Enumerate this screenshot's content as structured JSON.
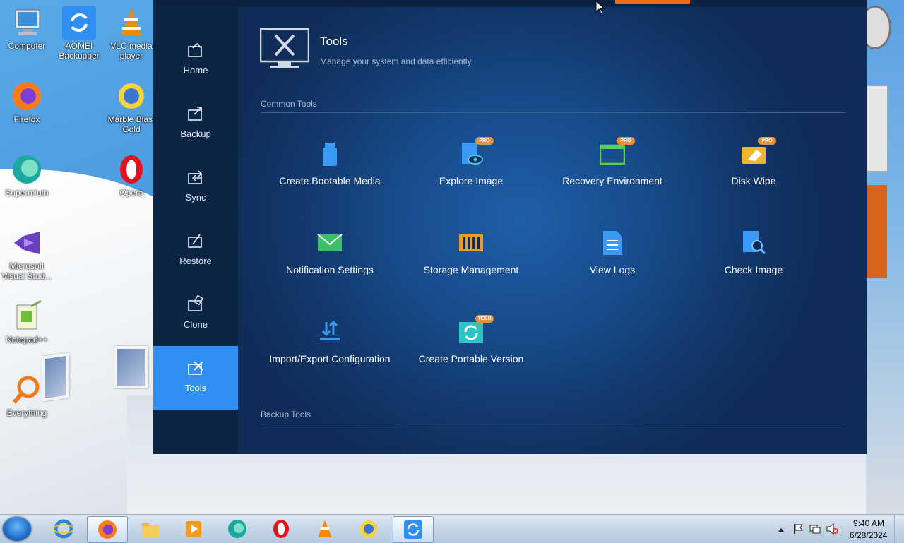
{
  "desktop": {
    "icons": [
      {
        "label": "Computer",
        "icon": "computer-icon"
      },
      {
        "label": "AOMEI Backupper",
        "icon": "aomei-icon"
      },
      {
        "label": "VLC media player",
        "icon": "vlc-icon"
      },
      {
        "label": "Firefox",
        "icon": "firefox-icon"
      },
      {
        "label": "Marble Blast Gold",
        "icon": "marble-blast-icon"
      },
      {
        "label": "Supermium",
        "icon": "supermium-icon"
      },
      {
        "label": "Opera",
        "icon": "opera-icon"
      },
      {
        "label": "Microsoft Visual Stud...",
        "icon": "visual-studio-icon"
      },
      {
        "label": "Notepad++",
        "icon": "notepadpp-icon"
      },
      {
        "label": "Everything",
        "icon": "everything-icon"
      }
    ]
  },
  "app": {
    "sidebar": [
      {
        "label": "Home",
        "icon": "home-icon"
      },
      {
        "label": "Backup",
        "icon": "backup-icon"
      },
      {
        "label": "Sync",
        "icon": "sync-icon"
      },
      {
        "label": "Restore",
        "icon": "restore-icon"
      },
      {
        "label": "Clone",
        "icon": "clone-icon"
      },
      {
        "label": "Tools",
        "icon": "tools-icon",
        "active": true
      }
    ],
    "header": {
      "title": "Tools",
      "subtitle": "Manage your system and data efficiently."
    },
    "sections": {
      "common": "Common Tools",
      "backup": "Backup Tools"
    },
    "tools": [
      {
        "label": "Create Bootable Media",
        "icon": "usb-drive-icon",
        "badge": ""
      },
      {
        "label": "Explore Image",
        "icon": "explore-image-icon",
        "badge": "PRO"
      },
      {
        "label": "Recovery Environment",
        "icon": "recovery-window-icon",
        "badge": "PRO"
      },
      {
        "label": "Disk Wipe",
        "icon": "disk-wipe-icon",
        "badge": "PRO"
      },
      {
        "label": "Notification Settings",
        "icon": "envelope-icon",
        "badge": ""
      },
      {
        "label": "Storage Management",
        "icon": "storage-icon",
        "badge": ""
      },
      {
        "label": "View Logs",
        "icon": "document-icon",
        "badge": ""
      },
      {
        "label": "Check Image",
        "icon": "check-image-icon",
        "badge": ""
      },
      {
        "label": "Import/Export Configuration",
        "icon": "import-export-icon",
        "badge": ""
      },
      {
        "label": "Create Portable Version",
        "icon": "portable-icon",
        "badge": "TECH"
      }
    ],
    "colors": {
      "accent": "#2f8ff2",
      "badge": "#e8913a",
      "background": "#0f2a4e"
    }
  },
  "taskbar": {
    "pinned": [
      "internet-explorer-icon",
      "firefox-icon",
      "file-explorer-icon",
      "media-player-icon",
      "supermium-icon",
      "opera-icon",
      "vlc-icon",
      "marble-blast-icon",
      "aomei-icon"
    ],
    "active": "aomei-icon",
    "clock": {
      "time": "9:40 AM",
      "date": "6/28/2024"
    }
  }
}
